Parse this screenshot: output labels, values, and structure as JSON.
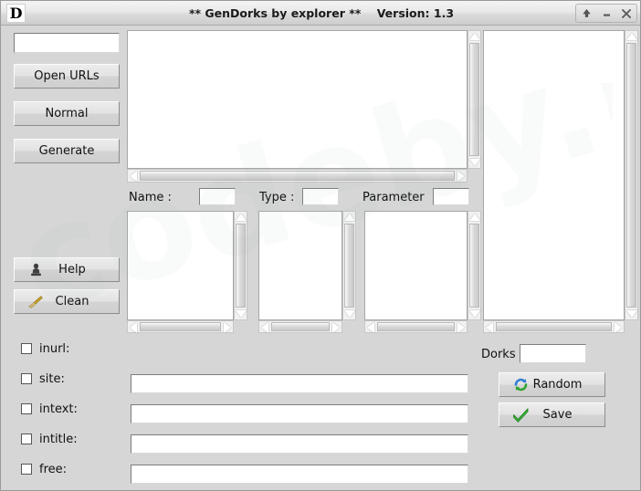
{
  "window": {
    "title": "** GenDorks by explorer **    Version: 1.3",
    "app_icon": "D",
    "app_icon_name": "app-logo-d",
    "controls": {
      "rollup": "⬆",
      "minimize": "–",
      "close": "✕"
    }
  },
  "watermark": {
    "text": "codeby.net"
  },
  "sidebar": {
    "url_field": {
      "value": "",
      "placeholder": ""
    },
    "buttons": [
      {
        "label": "Open URLs",
        "name": "open-urls-button"
      },
      {
        "label": "Normal",
        "name": "normal-button"
      },
      {
        "label": "Generate",
        "name": "generate-button"
      }
    ],
    "icon_buttons": [
      {
        "label": "Help",
        "name": "help-button",
        "icon": "person-icon"
      },
      {
        "label": "Clean",
        "name": "clean-button",
        "icon": "broom-icon"
      }
    ]
  },
  "main": {
    "output_area": {
      "value": ""
    },
    "fields": {
      "name_label": "Name :",
      "name_value": "",
      "type_label": "Type :",
      "type_value": "",
      "parameter_label": "Parameter",
      "parameter_value": ""
    },
    "lists": [
      {
        "name": "name-list",
        "items": []
      },
      {
        "name": "type-list",
        "items": []
      },
      {
        "name": "parameter-list",
        "items": []
      }
    ],
    "dorks_panel": {
      "items": []
    }
  },
  "operators": {
    "rows": [
      {
        "label": "inurl:",
        "checked": false,
        "name": "inurl",
        "has_input": false,
        "value": ""
      },
      {
        "label": "site:",
        "checked": false,
        "name": "site",
        "has_input": true,
        "value": ""
      },
      {
        "label": "intext:",
        "checked": false,
        "name": "intext",
        "has_input": true,
        "value": ""
      },
      {
        "label": "intitle:",
        "checked": false,
        "name": "intitle",
        "has_input": true,
        "value": ""
      },
      {
        "label": "free:",
        "checked": false,
        "name": "free",
        "has_input": true,
        "value": ""
      }
    ]
  },
  "right_bottom": {
    "dorks_label": "Dorks",
    "dorks_value": "",
    "random_label": "Random",
    "save_label": "Save"
  },
  "colors": {
    "window_bg": "#d6d6d6",
    "field_bg": "#ffffff",
    "title_text": "#1a1a1a",
    "accent_green": "#35a835",
    "accent_blue": "#3f7fd0"
  }
}
